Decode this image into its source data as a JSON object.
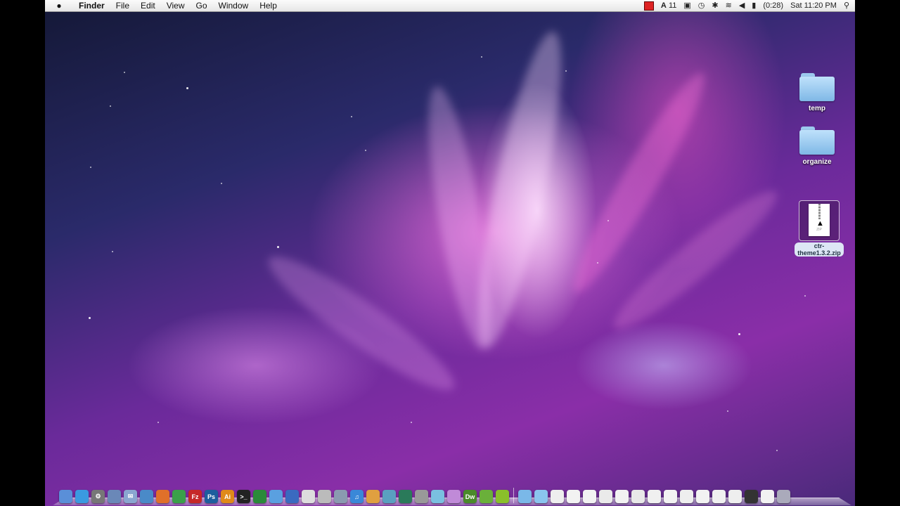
{
  "menubar": {
    "apple": "",
    "items": [
      "Finder",
      "File",
      "Edit",
      "View",
      "Go",
      "Window",
      "Help"
    ],
    "status": {
      "adobe": "11",
      "battery": "(0:28)",
      "clock": "Sat 11:20 PM"
    }
  },
  "desktop": {
    "icons": [
      {
        "label": "temp",
        "type": "folder"
      },
      {
        "label": "organize",
        "type": "folder"
      },
      {
        "label_line1": "ctr-",
        "label_line2": "theme1.3.2.zip",
        "badge": "ZIP",
        "type": "zip"
      }
    ]
  },
  "dock": {
    "apps": [
      {
        "name": "finder-icon",
        "color": "#5a8fd8",
        "glyph": ""
      },
      {
        "name": "safari-icon",
        "color": "#3a9ae0",
        "glyph": ""
      },
      {
        "name": "system-preferences-icon",
        "color": "#777",
        "glyph": "⚙"
      },
      {
        "name": "preview-icon",
        "color": "#6a88b8",
        "glyph": ""
      },
      {
        "name": "mail-icon",
        "color": "#8aa6d0",
        "glyph": "✉"
      },
      {
        "name": "globe-icon",
        "color": "#4a8ac8",
        "glyph": ""
      },
      {
        "name": "firefox-icon",
        "color": "#e0702a",
        "glyph": ""
      },
      {
        "name": "chrome-icon",
        "color": "#3aa04a",
        "glyph": ""
      },
      {
        "name": "filezilla-icon",
        "color": "#c62828",
        "glyph": "Fz"
      },
      {
        "name": "photoshop-icon",
        "color": "#1d5e9e",
        "glyph": "Ps"
      },
      {
        "name": "illustrator-icon",
        "color": "#e08a1a",
        "glyph": "Ai"
      },
      {
        "name": "terminal-icon",
        "color": "#222",
        "glyph": ">_"
      },
      {
        "name": "activity-monitor-icon",
        "color": "#2a8a3a",
        "glyph": ""
      },
      {
        "name": "ichat-icon",
        "color": "#5aa0e0",
        "glyph": ""
      },
      {
        "name": "imovie-icon",
        "color": "#3a6ac0",
        "glyph": ""
      },
      {
        "name": "textedit-icon",
        "color": "#ddd",
        "glyph": ""
      },
      {
        "name": "script-editor-icon",
        "color": "#bbb",
        "glyph": ""
      },
      {
        "name": "preview-pictures-icon",
        "color": "#8a9ab0",
        "glyph": ""
      },
      {
        "name": "itunes-icon",
        "color": "#3a88d8",
        "glyph": "♫"
      },
      {
        "name": "iphoto-icon",
        "color": "#e0a040",
        "glyph": ""
      },
      {
        "name": "garageband-icon",
        "color": "#5aa0c0",
        "glyph": ""
      },
      {
        "name": "time-machine-icon",
        "color": "#2a7a5a",
        "glyph": ""
      },
      {
        "name": "utility-icon",
        "color": "#999",
        "glyph": ""
      },
      {
        "name": "dashboard-icon",
        "color": "#7ac0e0",
        "glyph": ""
      },
      {
        "name": "photo-booth-icon",
        "color": "#c08ad8",
        "glyph": ""
      },
      {
        "name": "dreamweaver-icon",
        "color": "#4a8a2a",
        "glyph": "Dw"
      },
      {
        "name": "sync-icon",
        "color": "#6ab03a",
        "glyph": ""
      },
      {
        "name": "green-app-icon",
        "color": "#8ac02a",
        "glyph": ""
      }
    ],
    "stacks": [
      {
        "name": "folder-stack-icon",
        "color": "#7ab8e8"
      },
      {
        "name": "folder-stack-icon",
        "color": "#8ac4ee"
      },
      {
        "name": "document-stack-icon",
        "color": "#eee"
      },
      {
        "name": "window-stack-icon",
        "color": "#f2f2f2"
      },
      {
        "name": "window-stack-icon",
        "color": "#f2f2f2"
      },
      {
        "name": "window-stack-icon",
        "color": "#eaeaea"
      },
      {
        "name": "window-stack-icon",
        "color": "#f2f2f2"
      },
      {
        "name": "window-stack-icon",
        "color": "#e8e8e8"
      },
      {
        "name": "window-stack-icon",
        "color": "#f0f0f0"
      },
      {
        "name": "window-stack-icon",
        "color": "#f2f2f2"
      },
      {
        "name": "window-stack-icon",
        "color": "#eee"
      },
      {
        "name": "window-stack-icon",
        "color": "#f2f2f2"
      },
      {
        "name": "window-stack-icon",
        "color": "#f0f0f0"
      },
      {
        "name": "window-stack-icon",
        "color": "#eee"
      },
      {
        "name": "dark-window-stack-icon",
        "color": "#333"
      },
      {
        "name": "window-stack-icon",
        "color": "#f2f2f2"
      },
      {
        "name": "trash-icon",
        "color": "#aab"
      }
    ]
  }
}
